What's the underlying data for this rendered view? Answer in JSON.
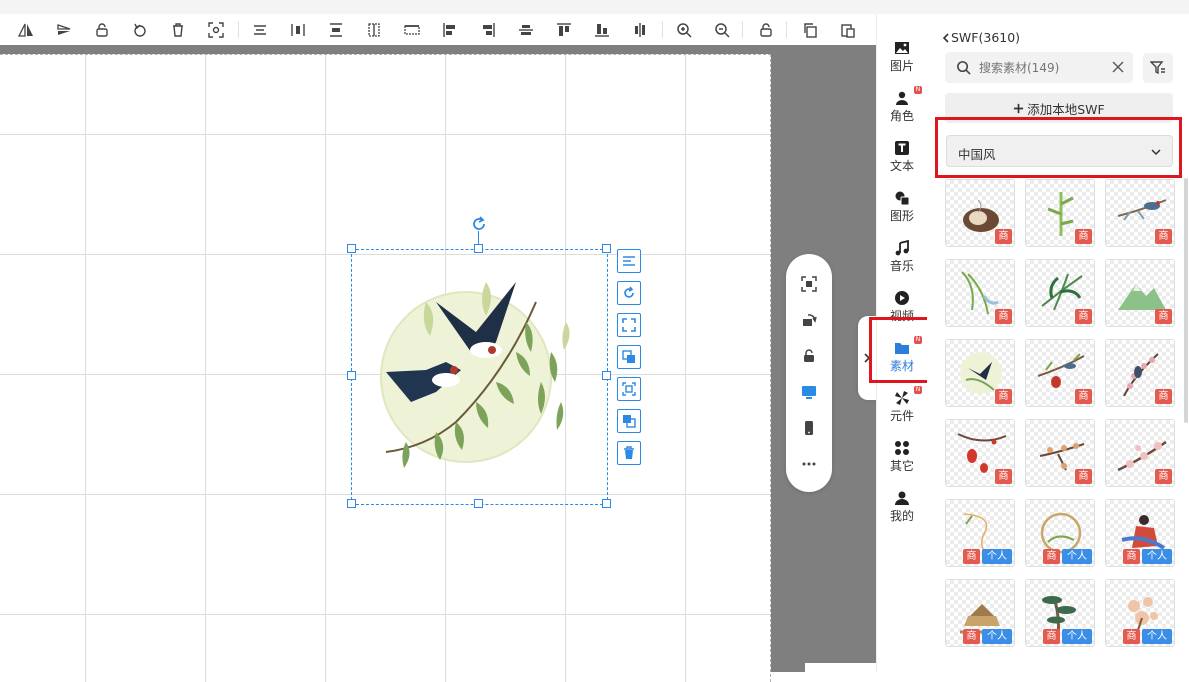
{
  "panel": {
    "back_label": "SWF(3610)",
    "search_placeholder": "搜索素材(149)",
    "add_label": "添加本地SWF",
    "category_selected": "中国风"
  },
  "categories": [
    {
      "label": "图片",
      "icon": "image-icon",
      "badge": ""
    },
    {
      "label": "角色",
      "icon": "person-icon",
      "badge": "N"
    },
    {
      "label": "文本",
      "icon": "text-icon",
      "badge": ""
    },
    {
      "label": "图形",
      "icon": "shape-icon",
      "badge": ""
    },
    {
      "label": "音乐",
      "icon": "music-icon",
      "badge": ""
    },
    {
      "label": "视频",
      "icon": "video-icon",
      "badge": ""
    },
    {
      "label": "素材",
      "icon": "folder-icon",
      "badge": "N"
    },
    {
      "label": "元件",
      "icon": "component-icon",
      "badge": "N"
    },
    {
      "label": "其它",
      "icon": "grid-icon",
      "badge": ""
    },
    {
      "label": "我的",
      "icon": "user-icon",
      "badge": ""
    }
  ],
  "tiles": [
    {
      "theme": "teapot",
      "badges": [
        "商"
      ]
    },
    {
      "theme": "bamboo",
      "badges": [
        "商"
      ]
    },
    {
      "theme": "bird-branch",
      "badges": [
        "商"
      ]
    },
    {
      "theme": "willow",
      "badges": [
        "商"
      ]
    },
    {
      "theme": "bamboo-leaves",
      "badges": [
        "商"
      ]
    },
    {
      "theme": "mountain",
      "badges": [
        "商"
      ]
    },
    {
      "theme": "swallows",
      "badges": [
        "商"
      ]
    },
    {
      "theme": "lantern-bird",
      "badges": [
        "商"
      ]
    },
    {
      "theme": "plum-bird",
      "badges": [
        "商"
      ]
    },
    {
      "theme": "lanterns",
      "badges": [
        "商"
      ]
    },
    {
      "theme": "autumn-branch",
      "badges": [
        "商"
      ]
    },
    {
      "theme": "blossom",
      "badges": [
        "商"
      ]
    },
    {
      "theme": "hanging-thread",
      "badges": [
        "商",
        "个人"
      ]
    },
    {
      "theme": "round-frame",
      "badges": [
        "商",
        "个人"
      ]
    },
    {
      "theme": "fairy",
      "badges": [
        "商",
        "个人"
      ]
    },
    {
      "theme": "pavilion",
      "badges": [
        "商",
        "个人"
      ]
    },
    {
      "theme": "pine",
      "badges": [
        "商",
        "个人"
      ]
    },
    {
      "theme": "peach-blossom",
      "badges": [
        "商",
        "个人"
      ]
    }
  ],
  "colors": {
    "accent": "#2b8ae5",
    "highlight": "#e0161e",
    "badge_shang": "#e45a4e",
    "badge_geren": "#3a8ee6"
  }
}
